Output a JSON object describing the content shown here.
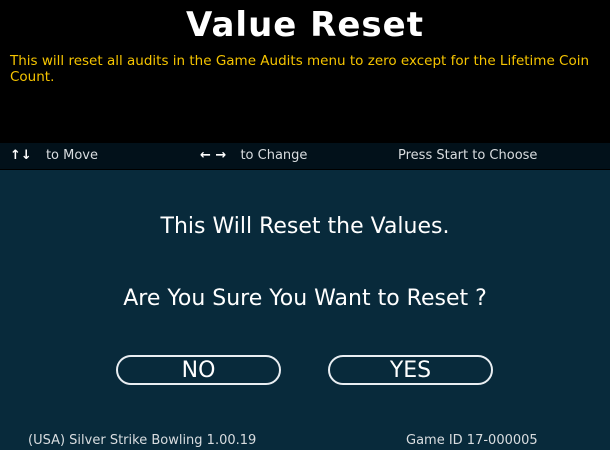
{
  "header": {
    "title": "Value   Reset"
  },
  "description": "This will reset all audits in the Game Audits menu to zero except for the Lifetime Coin Count.",
  "hints": {
    "move_glyph": "↑↓",
    "move_text": "to Move",
    "change_glyph": "← →",
    "change_text": "to Change",
    "choose_text": "Press Start to Choose"
  },
  "dialog": {
    "message1": "This Will Reset the Values.",
    "message2": "Are You Sure You Want to Reset ?",
    "no_label": "NO",
    "yes_label": "YES"
  },
  "footer": {
    "left": "(USA) Silver Strike Bowling 1.00.19",
    "right": "Game ID 17-000005"
  },
  "colors": {
    "background": "#000000",
    "panel": "#082a3b",
    "description_text": "#f5c400",
    "title_text": "#ffffff"
  }
}
